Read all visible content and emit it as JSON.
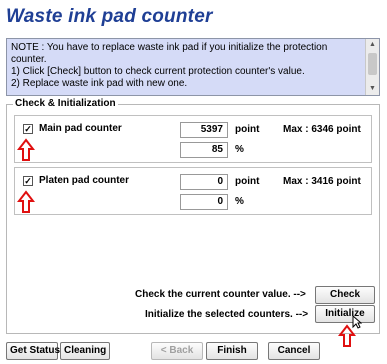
{
  "title": "Waste ink pad counter",
  "note": {
    "lines": [
      "NOTE : You have to replace waste ink pad if you initialize the protection",
      "counter.",
      "1) Click [Check] button to check current protection counter's value.",
      "2) Replace waste ink pad with new one."
    ]
  },
  "group": {
    "legend": "Check & Initialization",
    "rows": [
      {
        "checked": true,
        "label": "Main pad counter",
        "value": "5397",
        "unit": "point",
        "max": "Max : 6346 point",
        "percent": "85",
        "percent_unit": "%"
      },
      {
        "checked": true,
        "label": "Platen pad counter",
        "value": "0",
        "unit": "point",
        "max": "Max : 3416 point",
        "percent": "0",
        "percent_unit": "%"
      }
    ]
  },
  "actions": {
    "check_text": "Check the current counter value. -->",
    "check_button": "Check",
    "init_text": "Initialize the selected counters. -->",
    "init_button": "Initialize"
  },
  "footer": {
    "get_status": "Get Status",
    "cleaning": "Cleaning",
    "back": "< Back",
    "finish": "Finish",
    "cancel": "Cancel"
  },
  "colors": {
    "title": "#1f3f95",
    "note_bg": "#d5dbf7",
    "annotation_arrow": "#e01010"
  },
  "checkmark_glyph": "✓"
}
